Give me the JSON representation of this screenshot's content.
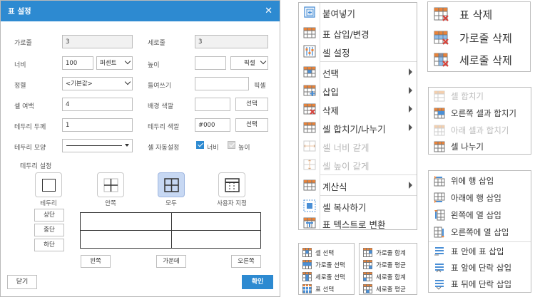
{
  "dialog": {
    "title": "표 설정",
    "close_icon": "close-icon",
    "fields": {
      "rows_label": "가로줄",
      "rows_value": "3",
      "cols_label": "세로줄",
      "cols_value": "3",
      "width_label": "너비",
      "width_value": "100",
      "width_unit": "퍼센트",
      "height_label": "높이",
      "height_value": "",
      "height_unit": "픽셀",
      "align_label": "정렬",
      "align_value": "<기본값>",
      "indent_label": "들여쓰기",
      "indent_value": "",
      "indent_unit": "픽셀",
      "padding_label": "셀 여백",
      "padding_value": "4",
      "bgcolor_label": "배경 색깔",
      "bgcolor_value": "",
      "bgcolor_btn": "선택",
      "border_width_label": "테두리 두께",
      "border_width_value": "1",
      "border_color_label": "테두리 색깔",
      "border_color_value": "#000",
      "border_color_btn": "선택",
      "border_style_label": "테두리 모양",
      "auto_size_label": "셀 자동설정",
      "auto_width_label": "너비",
      "auto_height_label": "높이"
    },
    "border_settings": {
      "label": "테두리 설정",
      "options": [
        "테두리",
        "안쪽",
        "모두",
        "사용자 지정"
      ],
      "selected": "모두",
      "top_btn": "상단",
      "middle_btn": "중단",
      "bottom_btn": "하단",
      "left_btn": "왼쪽",
      "center_btn": "가운데",
      "right_btn": "오른쪽"
    },
    "close_btn": "닫기",
    "ok_btn": "확인"
  },
  "context_menu": {
    "items": [
      {
        "label": "붙여넣기",
        "icon": "paste-icon"
      },
      {
        "label": "표 삽입/변경",
        "icon": "table-icon"
      },
      {
        "label": "셀 설정",
        "icon": "cell-settings-icon"
      },
      {
        "label": "선택",
        "icon": "table-select-icon"
      },
      {
        "label": "삽입",
        "icon": "table-insert-icon"
      },
      {
        "label": "삭제",
        "icon": "table-delete-icon"
      },
      {
        "label": "셀 합치기/나누기",
        "icon": "merge-split-icon"
      },
      {
        "label": "셀 너비 같게",
        "icon": "equal-width-icon"
      },
      {
        "label": "셀 높이 같게",
        "icon": "equal-height-icon"
      },
      {
        "label": "계산식",
        "icon": "formula-icon"
      },
      {
        "label": "셀 복사하기",
        "icon": "copy-cell-icon"
      },
      {
        "label": "표 텍스트로 변환",
        "icon": "table-to-text-icon"
      }
    ]
  },
  "delete_menu": {
    "items": [
      {
        "label": "표 삭제",
        "icon": "delete-table-icon"
      },
      {
        "label": "가로줄 삭제",
        "icon": "delete-row-icon"
      },
      {
        "label": "세로줄 삭제",
        "icon": "delete-column-icon"
      }
    ]
  },
  "merge_menu": {
    "items": [
      {
        "label": "셀 합치기",
        "icon": "merge-cells-icon"
      },
      {
        "label": "오른쪽 셀과 합치기",
        "icon": "merge-right-icon"
      },
      {
        "label": "아래 셀과 합치기",
        "icon": "merge-down-icon"
      },
      {
        "label": "셀 나누기",
        "icon": "split-cell-icon"
      }
    ]
  },
  "insert_menu": {
    "items": [
      {
        "label": "위에 행 삽입",
        "icon": "insert-row-above-icon"
      },
      {
        "label": "아래에 행 삽입",
        "icon": "insert-row-below-icon"
      },
      {
        "label": "왼쪽에 열 삽입",
        "icon": "insert-col-left-icon"
      },
      {
        "label": "오른쪽에 열 삽입",
        "icon": "insert-col-right-icon"
      },
      {
        "label": "표 안에 표 삽입",
        "icon": "nested-table-icon"
      },
      {
        "label": "표 앞에 단락 삽입",
        "icon": "paragraph-before-icon"
      },
      {
        "label": "표 뒤에 단락 삽입",
        "icon": "paragraph-after-icon"
      }
    ]
  },
  "select_menu": {
    "items": [
      {
        "label": "셀 선택",
        "icon": "select-cell-icon"
      },
      {
        "label": "가로줄 선택",
        "icon": "select-row-icon"
      },
      {
        "label": "세로줄 선택",
        "icon": "select-column-icon"
      },
      {
        "label": "표 선택",
        "icon": "select-table-icon"
      }
    ]
  },
  "sum_menu": {
    "items": [
      {
        "label": "가로줄 합계",
        "icon": "row-sum-icon"
      },
      {
        "label": "가로줄 평균",
        "icon": "row-average-icon"
      },
      {
        "label": "세로줄 합계",
        "icon": "col-sum-icon"
      },
      {
        "label": "세로줄 평균",
        "icon": "col-average-icon"
      }
    ]
  },
  "colors": {
    "accent": "#2d8ad1",
    "highlight": "#c7d8f3",
    "icon_orange": "#e8833a",
    "icon_red": "#d9413a",
    "icon_blue": "#4a8fd6"
  }
}
